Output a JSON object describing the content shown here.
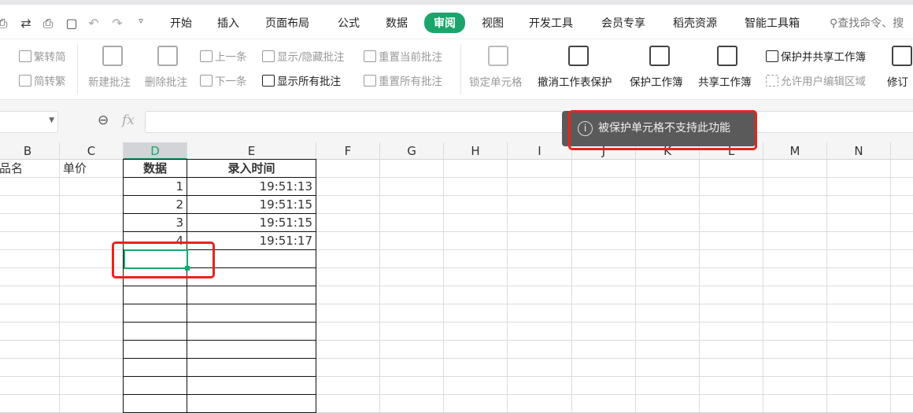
{
  "tabs": [
    "开始",
    "插入",
    "页面布局",
    "公式",
    "数据",
    "审阅",
    "视图",
    "开发工具",
    "会员专享",
    "稻壳资源",
    "智能工具箱"
  ],
  "active_tab": "审阅",
  "search_placeholder": "查找命令、搜",
  "ribbon": {
    "trad_to_simp": "繁转简",
    "simp_to_trad": "简转繁",
    "new_comment": "新建批注",
    "delete_comment": "删除批注",
    "prev": "上一条",
    "next": "下一条",
    "show_hide": "显示/隐藏批注",
    "show_all": "显示所有批注",
    "reset_current": "重置当前批注",
    "reset_all": "重置所有批注",
    "lock_cell": "锁定单元格",
    "unprotect_sheet": "撤消工作表保护",
    "protect_book": "保护工作簿",
    "share_book": "共享工作簿",
    "protect_share": "保护并共享工作簿",
    "allow_edit": "允许用户编辑区域",
    "revise": "修订"
  },
  "formula": {
    "fx": "fx",
    "value": ""
  },
  "columns": [
    "B",
    "C",
    "D",
    "E",
    "F",
    "G",
    "H",
    "I",
    "J",
    "K",
    "L",
    "M",
    "N"
  ],
  "selected_column": "D",
  "rows": [
    [
      "品名",
      "单价",
      "数据",
      "录入时间"
    ],
    [
      "",
      "",
      "1",
      "19:51:13"
    ],
    [
      "",
      "",
      "2",
      "19:51:15"
    ],
    [
      "",
      "",
      "3",
      "19:51:15"
    ],
    [
      "",
      "",
      "4",
      "19:51:17"
    ]
  ],
  "toast": {
    "icon": "info-icon",
    "message": "被保护单元格不支持此功能",
    "info_glyph": "i"
  }
}
